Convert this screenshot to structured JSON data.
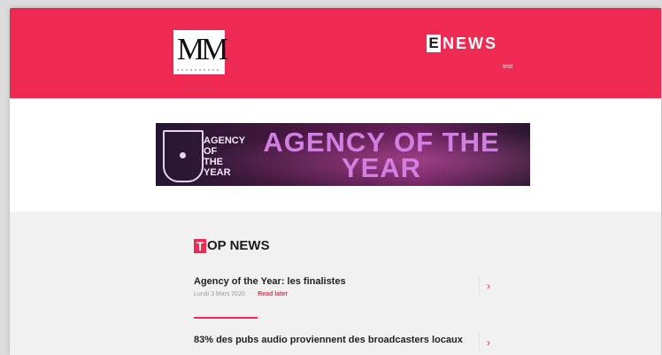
{
  "header": {
    "logo_text": "MM",
    "brand_letter": "E",
    "brand_rest": "NEWS",
    "test_label": "test",
    "color": "#ef2a52"
  },
  "banner": {
    "small_label": "AGENCY OF THE YEAR",
    "headline": "AGENCY OF THE YEAR"
  },
  "top_news": {
    "first_letter": "T",
    "rest": "OP NEWS",
    "articles": [
      {
        "title": "Agency of the Year: les finalistes",
        "date": "Lundi 3 Mars 2020",
        "read_later": "Read later"
      },
      {
        "title": "83% des pubs audio proviennent des broadcasters locaux",
        "date": "",
        "read_later": ""
      }
    ]
  },
  "icons": {
    "chevron": "›"
  }
}
